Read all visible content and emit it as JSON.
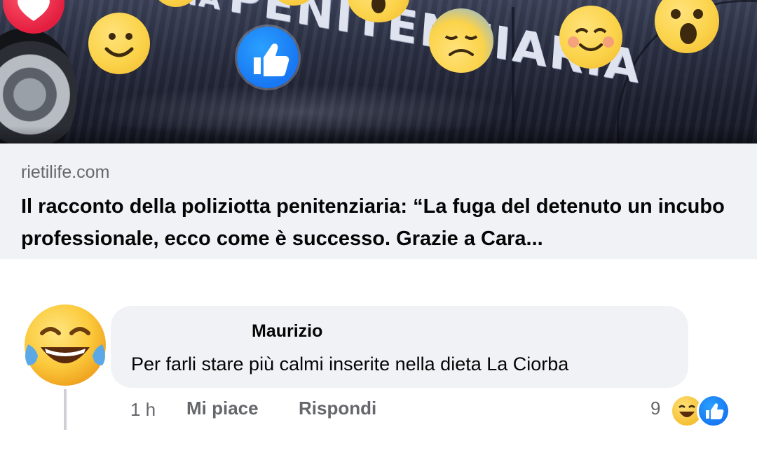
{
  "hero": {
    "car_text_small": "POLIZIA",
    "car_text_large": "PENITENZIARIA"
  },
  "link_preview": {
    "domain": "rietilife.com",
    "title": "Il racconto della poliziotta penitenziaria: “La fuga del detenuto un incubo professionale, ecco come è successo. Grazie a Cara..."
  },
  "comment": {
    "author": "Maurizio",
    "text": "Per farli stare più calmi inserite nella dieta La Ciorba",
    "age": "1 h",
    "like_label": "Mi piace",
    "reply_label": "Rispondi",
    "reaction_count": "9",
    "reactions": [
      "haha-icon",
      "like-icon"
    ]
  },
  "colors": {
    "like_blue": "#1877f2",
    "love_red": "#e41e3f",
    "bubble_bg": "#f0f2f5",
    "secondary_text": "#65676b"
  }
}
